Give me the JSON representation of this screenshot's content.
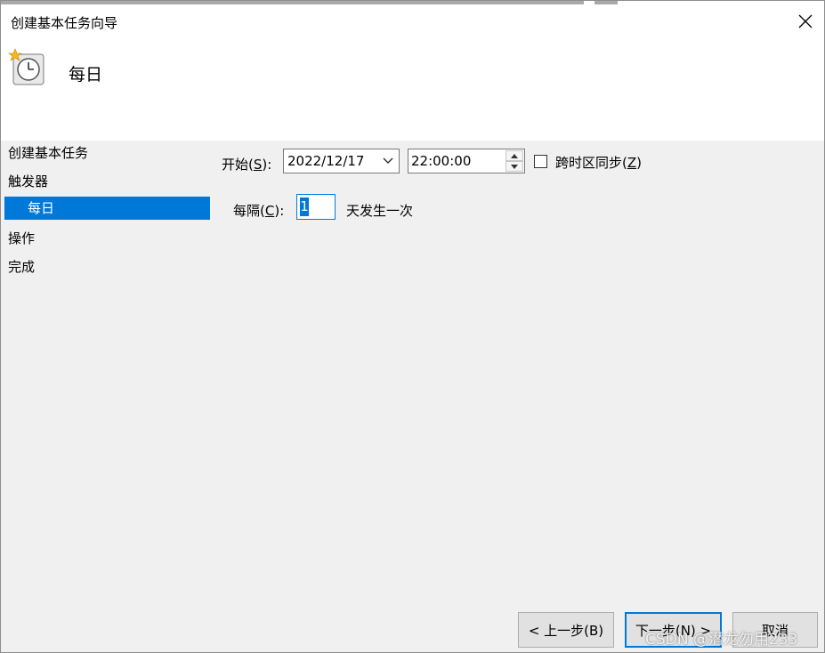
{
  "window": {
    "title": "创建基本任务向导"
  },
  "header": {
    "title": "每日"
  },
  "nav": {
    "items": [
      {
        "label": "创建基本任务"
      },
      {
        "label": "触发器"
      },
      {
        "label": "每日"
      },
      {
        "label": "操作"
      },
      {
        "label": "完成"
      }
    ],
    "selected_index": 2
  },
  "form": {
    "start_label_prefix": "开始(",
    "start_label_key": "S",
    "start_label_suffix": "):",
    "start_date": "2022/12/17",
    "start_time": "22:00:00",
    "sync_tz_label_prefix": "跨时区同步(",
    "sync_tz_label_key": "Z",
    "sync_tz_label_suffix": ")",
    "sync_tz_checked": false,
    "recur_label_prefix": "每隔(",
    "recur_label_key": "C",
    "recur_label_suffix": "):",
    "recur_value": "1",
    "recur_suffix": "天发生一次"
  },
  "buttons": {
    "back": "< 上一步(B)",
    "next": "下一步(N) >",
    "cancel": "取消"
  },
  "watermark": "CSDN @潜龙勿用233",
  "colors": {
    "accent": "#0078d7",
    "pane_bg": "#f0f0f0",
    "button_bg": "#e1e1e1"
  }
}
